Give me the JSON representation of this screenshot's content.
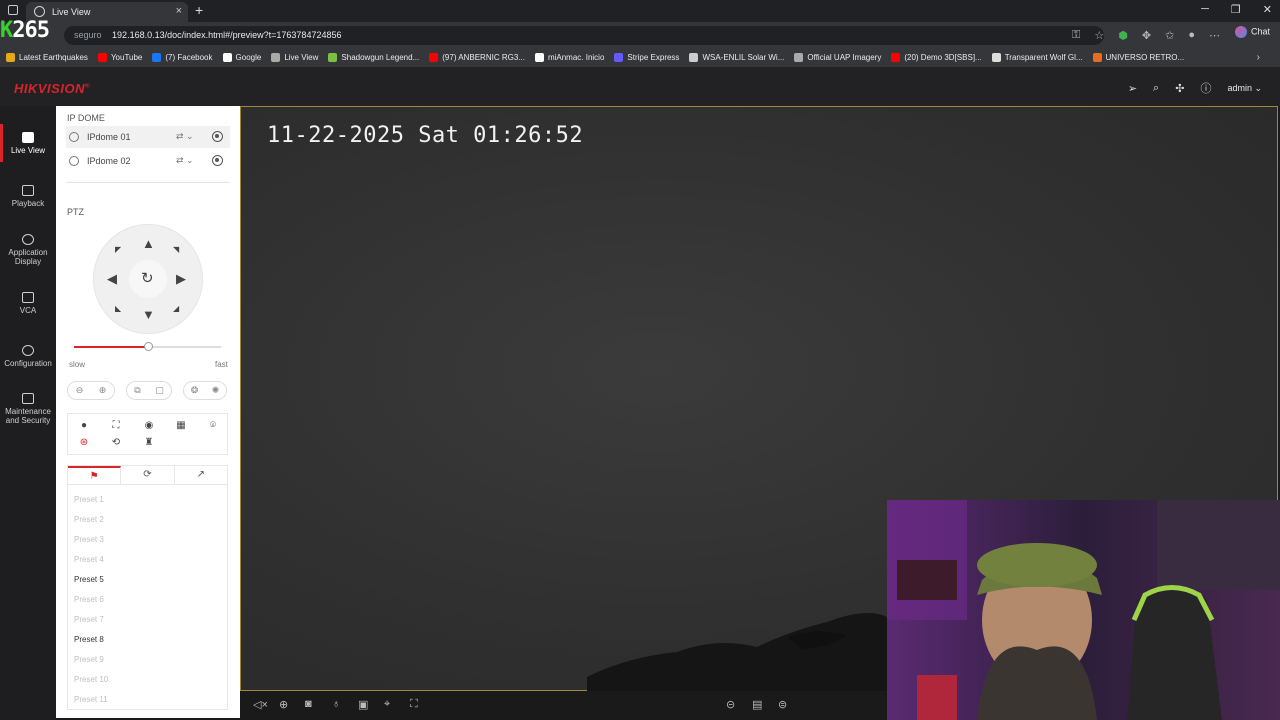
{
  "browser": {
    "tab_title": "Live View",
    "url_prefix": "seguro",
    "url": "192.168.0.13/doc/index.html#/preview?t=1763784724856",
    "chat_label": "Chat",
    "bookmarks": [
      {
        "label": "Latest Earthquakes",
        "color": "#e6a817"
      },
      {
        "label": "YouTube",
        "color": "#ff0000"
      },
      {
        "label": "(7) Facebook",
        "color": "#1877f2"
      },
      {
        "label": "Google",
        "color": "#ffffff"
      },
      {
        "label": "Live View",
        "color": "#aaaaaa"
      },
      {
        "label": "Shadowgun Legend...",
        "color": "#7ac043"
      },
      {
        "label": "(97) ANBERNIC RG3...",
        "color": "#ff0000"
      },
      {
        "label": "miAnmac. Inicio",
        "color": "#ffffff"
      },
      {
        "label": "Stripe Express",
        "color": "#635bff"
      },
      {
        "label": "WSA-ENLIL Solar Wi...",
        "color": "#cccccc"
      },
      {
        "label": "Official UAP Imagery",
        "color": "#aaaaaa"
      },
      {
        "label": "(20) Demo 3D[SBS]...",
        "color": "#ff0000"
      },
      {
        "label": "Transparent Wolf Gl...",
        "color": "#dddddd"
      },
      {
        "label": "UNIVERSO RETRO...",
        "color": "#e86c1f"
      }
    ]
  },
  "overlay_logo": {
    "k": "K",
    "num": "265"
  },
  "app": {
    "brand": "HIKVISION",
    "brand_mark": "®",
    "user": "admin"
  },
  "nav": [
    {
      "label": "Live View"
    },
    {
      "label": "Playback"
    },
    {
      "label": "Application Display"
    },
    {
      "label": "VCA"
    },
    {
      "label": "Configuration"
    },
    {
      "label": "Maintenance and Security"
    }
  ],
  "panel": {
    "device_group": "IP DOME",
    "cameras": [
      {
        "name": "IPdome 01"
      },
      {
        "name": "IPdome 02"
      }
    ],
    "ptz_title": "PTZ",
    "speed": {
      "slow": "slow",
      "fast": "fast",
      "level": 0.5
    },
    "presets": [
      {
        "label": "Preset 1",
        "set": false
      },
      {
        "label": "Preset 2",
        "set": false
      },
      {
        "label": "Preset 3",
        "set": false
      },
      {
        "label": "Preset 4",
        "set": false
      },
      {
        "label": "Preset 5",
        "set": true
      },
      {
        "label": "Preset 6",
        "set": false
      },
      {
        "label": "Preset 7",
        "set": false
      },
      {
        "label": "Preset 8",
        "set": true
      },
      {
        "label": "Preset 9",
        "set": false
      },
      {
        "label": "Preset 10",
        "set": false
      },
      {
        "label": "Preset 11",
        "set": false
      }
    ]
  },
  "video": {
    "osd_timestamp": "11-22-2025 Sat 01:26:52"
  },
  "colors": {
    "accent": "#d8242a",
    "video_border": "#9c8a3a"
  }
}
